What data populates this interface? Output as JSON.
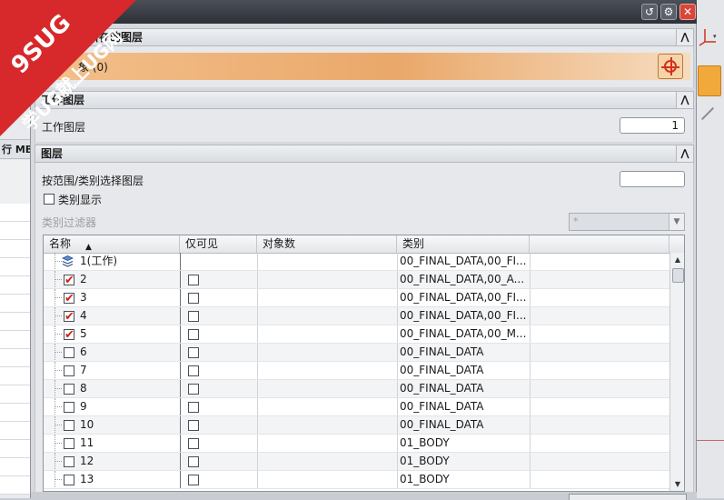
{
  "background_left": {
    "header_text": "行 MB"
  },
  "dialog": {
    "sections": {
      "object_layer": {
        "title": "象所在的图层",
        "select_label": "象 (0)"
      },
      "work_layer": {
        "title": "工作图层",
        "label": "工作图层",
        "value": "1"
      },
      "layers": {
        "title": "图层",
        "range_label": "按范围/类别选择图层",
        "range_value": "",
        "category_display_label": "类别显示",
        "category_filter_label": "类别过滤器",
        "category_filter_value": "*"
      }
    },
    "table": {
      "columns": [
        "名称",
        "仅可见",
        "对象数",
        "类别"
      ],
      "rows": [
        {
          "name": "1(工作)",
          "checked": null,
          "visible_only": false,
          "count": "",
          "category": "00_FINAL_DATA,00_FI..."
        },
        {
          "name": "2",
          "checked": true,
          "visible_only": false,
          "count": "",
          "category": "00_FINAL_DATA,00_A..."
        },
        {
          "name": "3",
          "checked": true,
          "visible_only": false,
          "count": "",
          "category": "00_FINAL_DATA,00_FI..."
        },
        {
          "name": "4",
          "checked": true,
          "visible_only": false,
          "count": "",
          "category": "00_FINAL_DATA,00_FI..."
        },
        {
          "name": "5",
          "checked": true,
          "visible_only": false,
          "count": "",
          "category": "00_FINAL_DATA,00_M..."
        },
        {
          "name": "6",
          "checked": false,
          "visible_only": false,
          "count": "",
          "category": "00_FINAL_DATA"
        },
        {
          "name": "7",
          "checked": false,
          "visible_only": false,
          "count": "",
          "category": "00_FINAL_DATA"
        },
        {
          "name": "8",
          "checked": false,
          "visible_only": false,
          "count": "",
          "category": "00_FINAL_DATA"
        },
        {
          "name": "9",
          "checked": false,
          "visible_only": false,
          "count": "",
          "category": "00_FINAL_DATA"
        },
        {
          "name": "10",
          "checked": false,
          "visible_only": false,
          "count": "",
          "category": "00_FINAL_DATA"
        },
        {
          "name": "11",
          "checked": false,
          "visible_only": false,
          "count": "",
          "category": "01_BODY"
        },
        {
          "name": "12",
          "checked": false,
          "visible_only": false,
          "count": "",
          "category": "01_BODY"
        },
        {
          "name": "13",
          "checked": false,
          "visible_only": false,
          "count": "",
          "category": "01_BODY"
        }
      ]
    }
  },
  "watermark": {
    "line1": "9SUG",
    "line2": "学UG就上UG网"
  },
  "colors": {
    "accent_orange": "#eaa86a",
    "check_red": "#d0201a",
    "titlebar": "#2d3037",
    "close_red": "#d9473a"
  },
  "icons": [
    "reset-icon",
    "gear-icon",
    "close-icon",
    "collapse-icon",
    "target-icon",
    "layer-stack-icon",
    "sort-asc-icon",
    "dropdown-arrow-icon"
  ]
}
